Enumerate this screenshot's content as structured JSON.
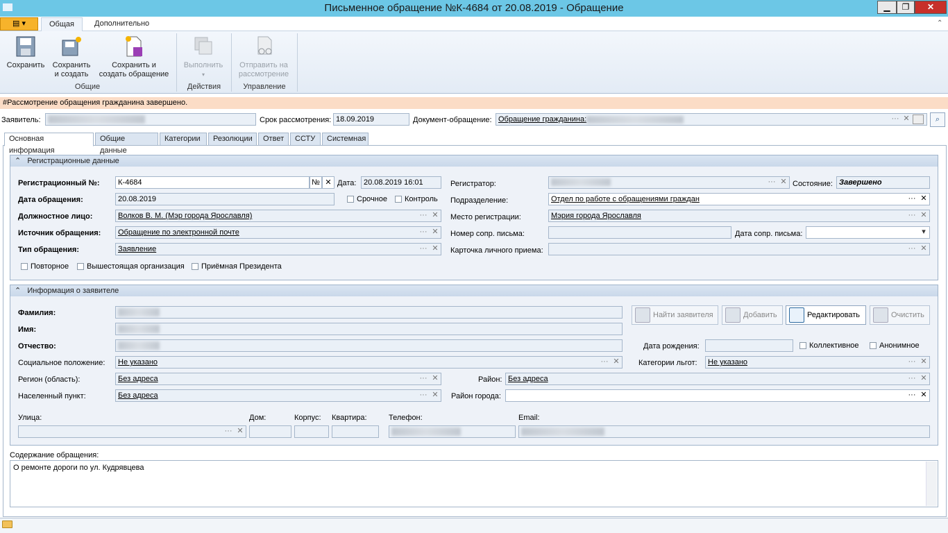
{
  "window": {
    "title": "Письменное обращение №К-4684 от 20.08.2019 - Обращение",
    "min": "▁",
    "max": "❐",
    "close": "✕"
  },
  "ribbon": {
    "tabs": [
      "Общая",
      "Дополнительно"
    ],
    "buttons": {
      "save": "Сохранить",
      "save_create1": "Сохранить",
      "save_create2": "и создать",
      "save_create_req1": "Сохранить и",
      "save_create_req2": "создать обращение",
      "execute": "Выполнить",
      "send1": "Отправить на",
      "send2": "рассмотрение"
    },
    "groups": {
      "general": "Общие",
      "actions": "Действия",
      "management": "Управление"
    }
  },
  "notice": "#Рассмотрение обращения гражданина завершено.",
  "header": {
    "applicant_label": "Заявитель:",
    "deadline_label": "Срок рассмотрения:",
    "deadline": "18.09.2019",
    "doc_label": "Документ-обращение:",
    "doc_value": "Обращение гражданина:"
  },
  "tabs": [
    "Основная информация",
    "Общие данные",
    "Категории",
    "Резолюции",
    "Ответ",
    "ССТУ",
    "Системная"
  ],
  "reg": {
    "title": "Регистрационные данные",
    "regnum_label": "Регистрационный №:",
    "regnum": "К-4684",
    "num_btn": "№",
    "date_label": "Дата:",
    "date": "20.08.2019 16:01",
    "regdate_label": "Дата обращения:",
    "regdate": "20.08.2019",
    "urgent": "Срочное",
    "control": "Контроль",
    "official_label": "Должностное лицо:",
    "official": "Волков В. М. (Мэр города Ярославля)",
    "source_label": "Источник обращения:",
    "source": "Обращение по электронной почте",
    "type_label": "Тип обращения:",
    "type": "Заявление",
    "repeat": "Повторное",
    "higher": "Вышестоящая организация",
    "president": "Приёмная Президента",
    "registrar_label": "Регистратор:",
    "state_label": "Состояние:",
    "state": "Завершено",
    "dept_label": "Подразделение:",
    "dept": "Отдел по работе с обращениями граждан",
    "place_label": "Место регистрации:",
    "place": "Мэрия города Ярославля",
    "cover_num_label": "Номер сопр. письма:",
    "cover_date_label": "Дата сопр. письма:",
    "card_label": "Карточка личного приема:"
  },
  "applicant": {
    "title": "Информация о заявителе",
    "surname": "Фамилия:",
    "name": "Имя:",
    "patronymic": "Отчество:",
    "find": "Найти заявителя",
    "add": "Добавить",
    "edit": "Редактировать",
    "clear": "Очистить",
    "birth_label": "Дата рождения:",
    "collective": "Коллективное",
    "anonymous": "Анонимное",
    "social_label": "Социальное положение:",
    "social": "Не указано",
    "benefits_label": "Категории льгот:",
    "benefits": "Не указано",
    "region_label": "Регион (область):",
    "region": "Без адреса",
    "district_label": "Район:",
    "district": "Без адреса",
    "locality_label": "Населенный пункт:",
    "locality": "Без адреса",
    "city_district_label": "Район города:",
    "street": "Улица:",
    "house": "Дом:",
    "building": "Корпус:",
    "flat": "Квартира:",
    "phone": "Телефон:",
    "email": "Email:"
  },
  "content": {
    "label": "Содержание обращения:",
    "text": "О ремонте дороги по ул. Кудрявцева"
  },
  "icons": {
    "dots": "···",
    "x": "✕",
    "drop": "▾"
  }
}
